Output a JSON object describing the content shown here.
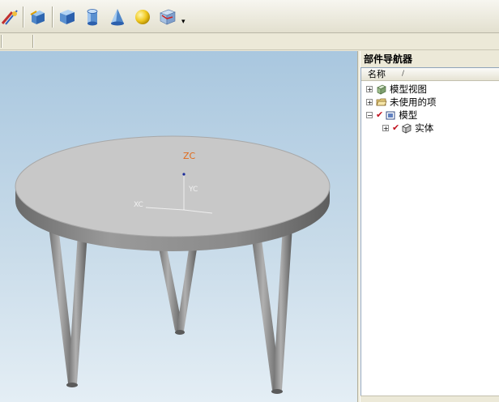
{
  "navigator": {
    "title": "部件导航器",
    "column_name": "名称",
    "sort_glyph": "/",
    "items": [
      {
        "label": "模型视图",
        "expander": "+"
      },
      {
        "label": "未使用的项",
        "expander": "+"
      },
      {
        "label": "模型",
        "expander": "−"
      },
      {
        "label": "实体",
        "expander": "+"
      }
    ]
  },
  "viewport": {
    "axis_z": "ZC",
    "axis_y": "YC",
    "axis_x": "XC"
  },
  "icons": {
    "toolbar": [
      "sketch-icon",
      "block-icon",
      "cube-icon",
      "cylinder-icon",
      "cone-icon",
      "sphere-icon",
      "csys-icon"
    ],
    "dropdown_glyph": "▾"
  },
  "colors": {
    "check": "#c1121f",
    "axis_z": "#e06a1a"
  }
}
